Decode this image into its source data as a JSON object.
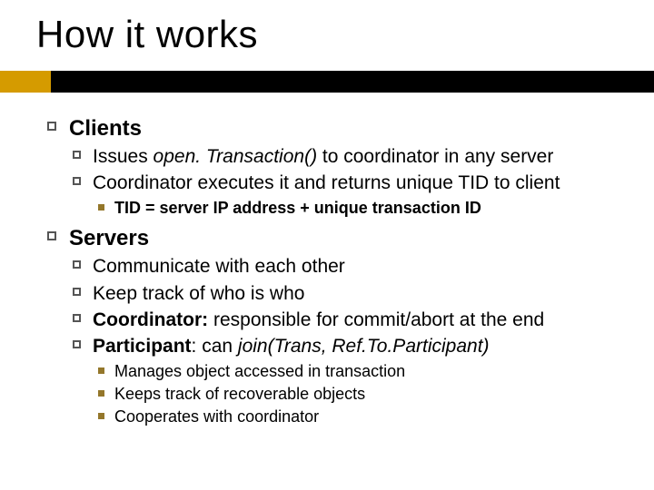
{
  "title": "How it works",
  "colors": {
    "accent": "#d59b00",
    "bar": "#000000",
    "bullet3": "#94772b"
  },
  "sections": [
    {
      "heading": "Clients",
      "items": [
        {
          "pre": "Issues ",
          "ital": "open. Transaction()",
          "post": " to coordinator in any server"
        },
        {
          "text": "Coordinator executes it and returns unique TID to client",
          "sub": [
            {
              "text": "TID = server IP address + unique transaction ID",
              "bold": true
            }
          ]
        }
      ]
    },
    {
      "heading": "Servers",
      "items": [
        {
          "text": "Communicate with each other"
        },
        {
          "text": "Keep track of who is who"
        },
        {
          "boldPrefix": "Coordinator:",
          "rest": " responsible for commit/abort at the end"
        },
        {
          "boldPrefix": "Participant",
          "rest": ": can ",
          "ital": "join(Trans, Ref.To.Participant)",
          "sub": [
            {
              "text": "Manages object accessed in transaction"
            },
            {
              "text": "Keeps track of recoverable objects"
            },
            {
              "text": "Cooperates with coordinator"
            }
          ]
        }
      ]
    }
  ]
}
